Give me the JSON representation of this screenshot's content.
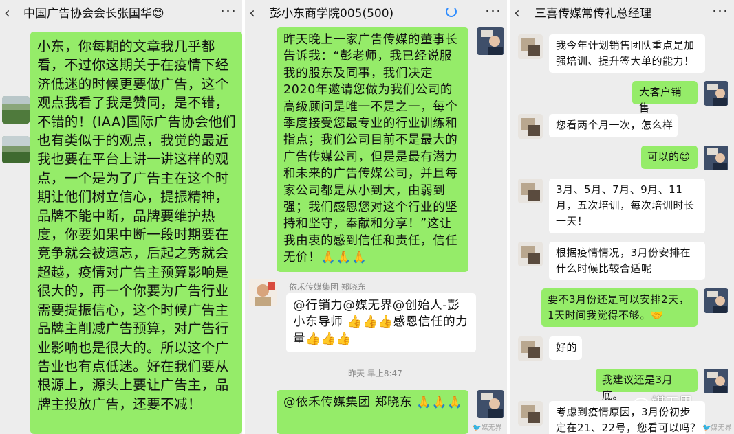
{
  "panel1": {
    "title": "中国广告协会会长张国华😊",
    "message": "小东，你每期的文章我几乎都看，不过你这期关于在疫情下经济低迷的时候更要做广告，这个观点我看了我是赞同，是不错，不错的！(IAA)国际广告协会他们也有类似于的观点，我觉的最近我也要在平台上讲一讲这样的观点，一个是为了广告主在这个时期让他们树立信心，提振精神，品牌不能中断，品牌要维护热度，你要如果中断一段时期要在竞争就会被遗忘，后起之秀就会超越，疫情对广告主预算影响是很大的，再一个你要为广告行业需要提振信心，这个时候广告主品牌主削减广告预算，对广告行业影响也是很大的。所以这个广告业也有点低迷。好在我们要从根源上，源头上要让广告主，品牌主投放广告，还要不减！"
  },
  "panel2": {
    "title": "彭小东商学院005(500)",
    "msg1": "昨天晚上一家广告传媒的董事长告诉我：“彭老师，我已经说服我的股东及同事，我们决定2020年邀请您做为我们公司的高级顾问是唯一不是之一，每个季度接受您最专业的行业训练和指点；我们公司目前不是最大的广告传媒公司，但是是最有潜力和未来的广告传媒公司，并且每家公司都是从小到大，由弱到强；我们感恩您对这个行业的坚持和坚守，奉献和分享！”这让我由衷的感到信任和责任，信任无价！🙏🙏🙏",
    "sender": "依禾传媒集团 郑晓东",
    "msg2": "@行销力@媒无界@创始人-彭小东导师 👍👍👍感恩信任的力量👍👍👍",
    "time": "昨天 早上8:47",
    "msg3": "@依禾传媒集团 郑晓东 🙏🙏🙏",
    "watermark": "🐦媒无界"
  },
  "panel3": {
    "title": "三喜传媒常传礼总经理",
    "messages": [
      {
        "side": "left",
        "text": "我今年计划销售团队重点是加强培训、提升签大单的能力！"
      },
      {
        "side": "right",
        "text": "大客户销售"
      },
      {
        "side": "left",
        "text": "您看两个月一次，怎么样"
      },
      {
        "side": "right",
        "text": "可以的😊"
      },
      {
        "side": "left",
        "text": "3月、5月、7月、9月、11月，五次培训，每次培训时长一天！"
      },
      {
        "side": "left",
        "text": "根据疫情情况，3月份安排在什么时候比较合适呢"
      },
      {
        "side": "right",
        "text": "要不3月份还是可以安排2天，1天时间我觉得不够。🤝"
      },
      {
        "side": "left",
        "text": "好的"
      },
      {
        "side": "right",
        "text": "我建议还是3月底。"
      },
      {
        "side": "left",
        "text": "考虑到疫情原因，3月份初步定在21、22号，您看可以吗？"
      }
    ],
    "watermark_big": "媒无界",
    "watermark_small": "🐦媒无界"
  },
  "colors": {
    "chat_bg": "#ededed",
    "sent_bubble": "#95ec69",
    "received_bubble": "#ffffff"
  },
  "icons": [
    "back-arrow-icon",
    "more-dots-icon",
    "loading-circle-icon"
  ]
}
